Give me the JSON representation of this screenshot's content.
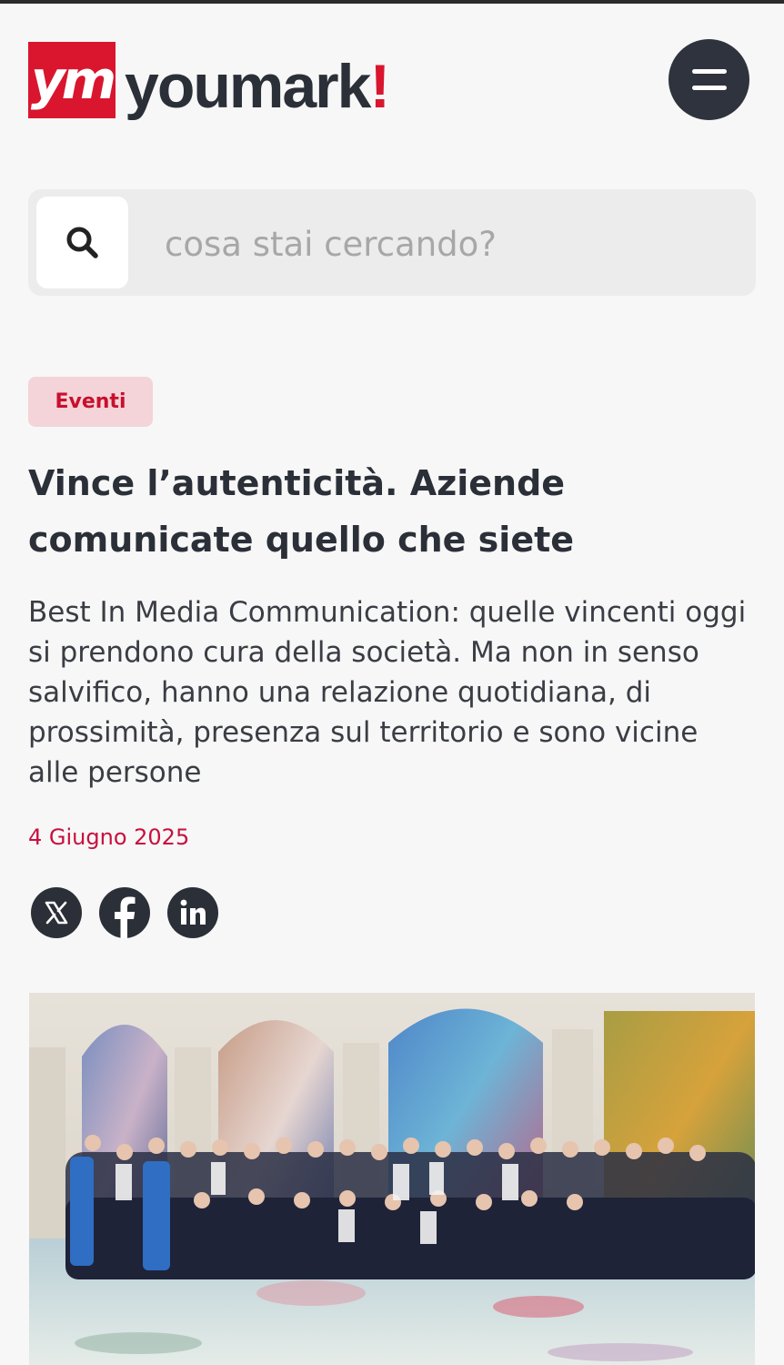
{
  "header": {
    "logo_mark": "ym",
    "logo_word": "youmark",
    "logo_accent": "!",
    "menu_icon": "hamburger-icon"
  },
  "search": {
    "placeholder": "cosa stai cercando?",
    "value": "",
    "icon": "search-icon"
  },
  "article": {
    "category": "Eventi",
    "title": "Vince l’autenticità. Aziende comunicate quello che siete",
    "summary": "Best In Media Communication: quelle vincenti oggi si prendono cura della società. Ma non in senso salvifico, hanno una relazione quotidiana, di prossimità, presenza sul territorio e sono vicine alle persone",
    "date": "4 Giugno 2025"
  },
  "share": {
    "items": [
      {
        "icon": "x-twitter-icon"
      },
      {
        "icon": "facebook-icon"
      },
      {
        "icon": "linkedin-icon"
      }
    ]
  },
  "colors": {
    "brand_red": "#d9162e",
    "dark": "#2b2f38",
    "badge_bg": "#f4d4d8",
    "date_red": "#c8103f",
    "background": "#f7f7f7"
  }
}
